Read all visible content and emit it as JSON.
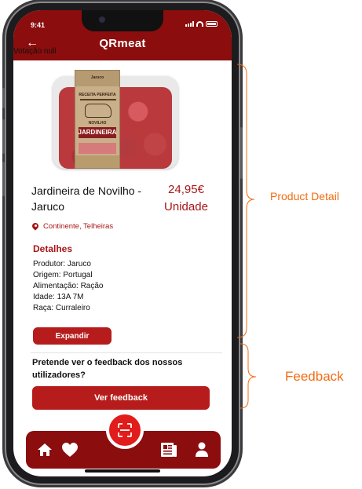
{
  "status_bar": {
    "time": "9:41"
  },
  "header": {
    "title": "QRmeat",
    "back_icon": "back-arrow-icon",
    "debug_text": "Votação null"
  },
  "product": {
    "name": "Jardineira de Novilho - Jaruco",
    "price": "24,95€",
    "unit": "Unidade",
    "location": "Continente, Telheiras",
    "package_label": {
      "brand": "Jaruco",
      "line1": "RECEITA PERFEITA",
      "line2": "NOVILHO",
      "line3": "JARDINEIRA"
    }
  },
  "details": {
    "title": "Detalhes",
    "items": [
      "Produtor: Jaruco",
      "Origem: Portugal",
      "Alimentação: Ração",
      "Idade: 13A 7M",
      "Raça: Curraleiro"
    ],
    "expand_label": "Expandir"
  },
  "feedback": {
    "question": "Pretende ver o feedback dos nossos utilizadores?",
    "button_label": "Ver feedback"
  },
  "nav": {
    "items": [
      "home-icon",
      "heart-icon",
      "scan-icon",
      "news-icon",
      "user-icon"
    ]
  },
  "annotations": {
    "product_detail": "Product Detail",
    "feedback": "Feedback"
  },
  "colors": {
    "brand_dark": "#8b0d0d",
    "brand": "#b71c1c",
    "accent_fab": "#e21b1b",
    "annotation": "#f36b12"
  }
}
